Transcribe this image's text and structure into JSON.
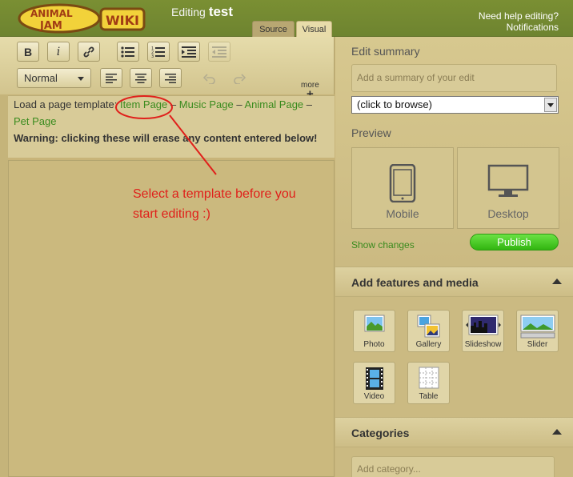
{
  "header": {
    "logo_text": "Animal Jam Wiki",
    "editing_label": "Editing",
    "page_name": "test",
    "tabs": [
      {
        "label": "Source"
      },
      {
        "label": "Visual"
      }
    ],
    "help_link": "Need help editing?",
    "notifications_link": "Notifications"
  },
  "toolbar": {
    "bold": "B",
    "italic": "i",
    "format_select": "Normal",
    "more_label": "more",
    "more_plus": "+"
  },
  "template_bar": {
    "prompt": "Load a page template:",
    "links": [
      "Item Page",
      "Music Page",
      "Animal Page",
      "Pet Page"
    ],
    "separator": "–",
    "warning": "Warning: clicking these will erase any content entered below!"
  },
  "annotation": {
    "line1": "Select a template before you",
    "line2": "start editing :)",
    "color": "#e0201b"
  },
  "right_panel": {
    "edit_summary_title": "Edit summary",
    "summary_placeholder": "Add a summary of your edit",
    "browse_value": "(click to browse)",
    "preview_title": "Preview",
    "preview_buttons": [
      "Mobile",
      "Desktop"
    ],
    "show_changes": "Show changes",
    "publish": "Publish",
    "features_title": "Add features and media",
    "features": [
      {
        "label": "Photo",
        "icon": "photo-icon"
      },
      {
        "label": "Gallery",
        "icon": "gallery-icon"
      },
      {
        "label": "Slideshow",
        "icon": "slideshow-icon"
      },
      {
        "label": "Slider",
        "icon": "slider-icon"
      },
      {
        "label": "Video",
        "icon": "video-icon"
      },
      {
        "label": "Table",
        "icon": "table-icon"
      }
    ],
    "categories_title": "Categories",
    "category_placeholder": "Add category..."
  },
  "colors": {
    "top_bar": "#6e8430",
    "link_green": "#3a8b1e",
    "publish_green": "#31b510",
    "panel_tan": "#cbba82"
  }
}
